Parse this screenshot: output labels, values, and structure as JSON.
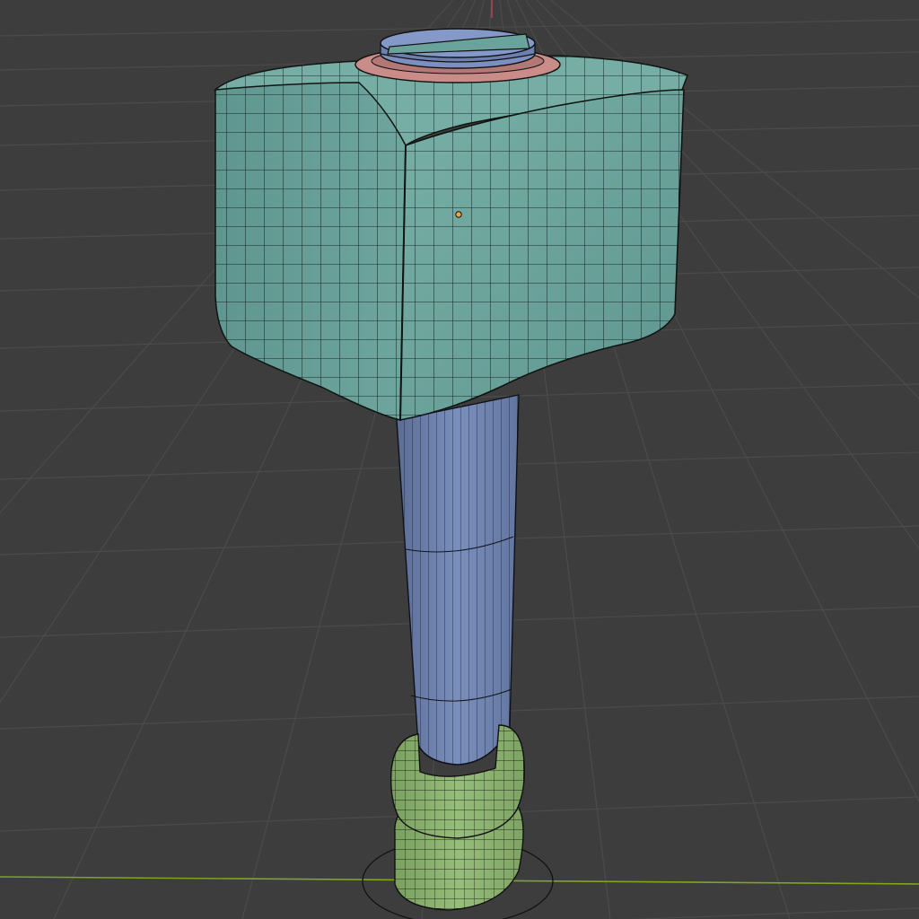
{
  "viewport": {
    "background": "#3d3d3d",
    "grid_color": "#4a4a4a",
    "x_axis_color": "#7fa51e",
    "y_axis_color": "#a8454f"
  },
  "object": {
    "name": "hammer",
    "head_color": "#6aa39c",
    "handle_color": "#6f82ad",
    "top_cap_color": "#7d8fc0",
    "ring_color": "#c98c89",
    "grip_color": "#8bb06f",
    "wire_color": "#101312",
    "origin_color": "#f0a43a"
  }
}
